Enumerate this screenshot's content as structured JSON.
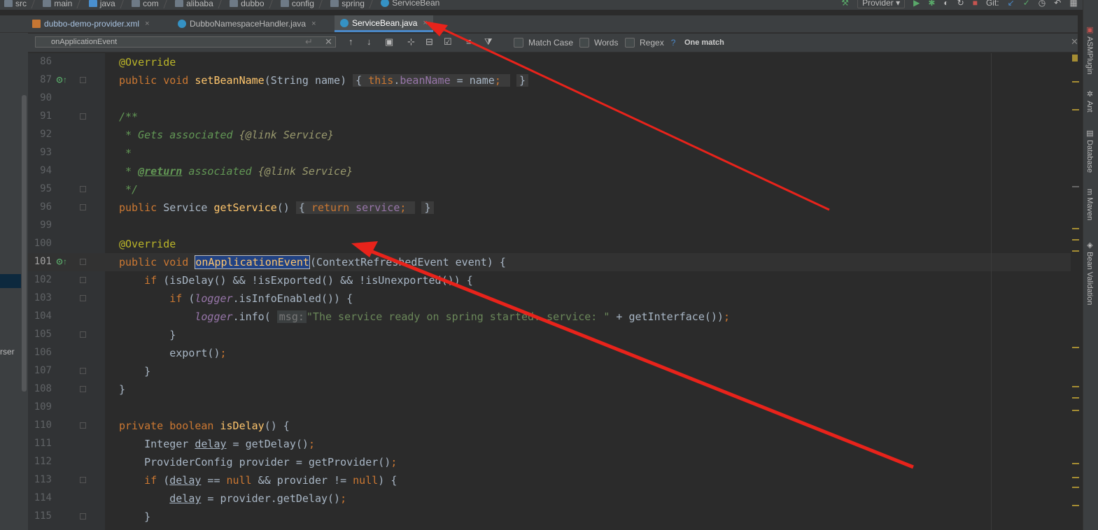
{
  "breadcrumb": [
    "src",
    "main",
    "java",
    "com",
    "alibaba",
    "dubbo",
    "config",
    "spring",
    "ServiceBean"
  ],
  "toolbar": {
    "run_config": "Provider ▾",
    "git_label": "Git:"
  },
  "tabs": [
    {
      "label": "dubbo-demo-provider.xml",
      "close": "×"
    },
    {
      "label": "DubboNamespaceHandler.java",
      "close": "×"
    },
    {
      "label": "ServiceBean.java",
      "close": "×"
    }
  ],
  "find": {
    "query": "onApplicationEvent",
    "match_case_label": "Match Case",
    "words_label": "Words",
    "regex_label": "Regex",
    "regex_help": "?",
    "match_count": "One match"
  },
  "left_panel_text": "rser",
  "right_tools": [
    "ASMPlugin",
    "Ant",
    "Database",
    "Maven",
    "Bean Validation"
  ],
  "line_numbers": [
    "86",
    "87",
    "90",
    "91",
    "92",
    "93",
    "94",
    "95",
    "96",
    "99",
    "100",
    "101",
    "102",
    "103",
    "104",
    "105",
    "106",
    "107",
    "108",
    "109",
    "110",
    "111",
    "112",
    "113",
    "114",
    "115"
  ],
  "code": {
    "l86_ann": "@Override",
    "l87_kw": "public void ",
    "l87_fn": "setBeanName",
    "l87_rest": "(String name)",
    "l87_fold": "{ ",
    "l87_this": "this",
    "l87_dot": ".",
    "l87_field": "beanName",
    "l87_eq": " = name",
    "l87_semi": ";",
    "l87_close": "}",
    "l91": "/**",
    "l92_a": " * Gets associated ",
    "l92_link": "{@link ",
    "l92_b": "Service}",
    "l93": " *",
    "l94_a": " * ",
    "l94_tag": "@return",
    "l94_b": " associated ",
    "l94_link": "{@link ",
    "l94_c": "Service}",
    "l95": " */",
    "l96_kw": "public ",
    "l96_type": "Service ",
    "l96_fn": "getService",
    "l96_rest": "()",
    "l96_fold_open": "{ ",
    "l96_ret": "return ",
    "l96_field": "service",
    "l96_semi": ";",
    "l96_close": "}",
    "l100_ann": "@Override",
    "l101_kw": "public void ",
    "l101_fn": "onApplicationEvent",
    "l101_rest": "(ContextRefreshedEvent event) {",
    "l102_kw": "if ",
    "l102_rest": "(isDelay() && !isExported() && !isUnexported()) {",
    "l103_kw": "if ",
    "l103_p": "(",
    "l103_field": "logger",
    "l103_rest": ".isInfoEnabled()) {",
    "l104_field": "logger",
    "l104_call": ".info(",
    "l104_hint": "msg:",
    "l104_str": "\"The service ready on spring started. service: \"",
    "l104_rest": " + getInterface())",
    "l104_semi": ";",
    "l105": "}",
    "l106_call": "export()",
    "l106_semi": ";",
    "l107": "}",
    "l108": "}",
    "l110_kw": "private boolean ",
    "l110_fn": "isDelay",
    "l110_rest": "() {",
    "l111_a": "Integer ",
    "l111_var": "delay",
    "l111_b": " = getDelay()",
    "l111_semi": ";",
    "l112_a": "ProviderConfig provider = getProvider()",
    "l112_semi": ";",
    "l113_kw": "if ",
    "l113_p": "(",
    "l113_var": "delay",
    "l113_eq": " == ",
    "l113_null1": "null",
    "l113_and": " && provider != ",
    "l113_null2": "null",
    "l113_rest": ") {",
    "l114_var": "delay",
    "l114_rest": " = provider.getDelay()",
    "l114_semi": ";",
    "l115": "}"
  },
  "colors": {
    "background": "#2b2b2b",
    "keyword": "#cc7832",
    "annotation": "#bbb529",
    "method": "#ffc66d",
    "field": "#9876aa",
    "doc": "#629755",
    "string": "#6a8759",
    "annotation_arrow": "#e8231b"
  }
}
